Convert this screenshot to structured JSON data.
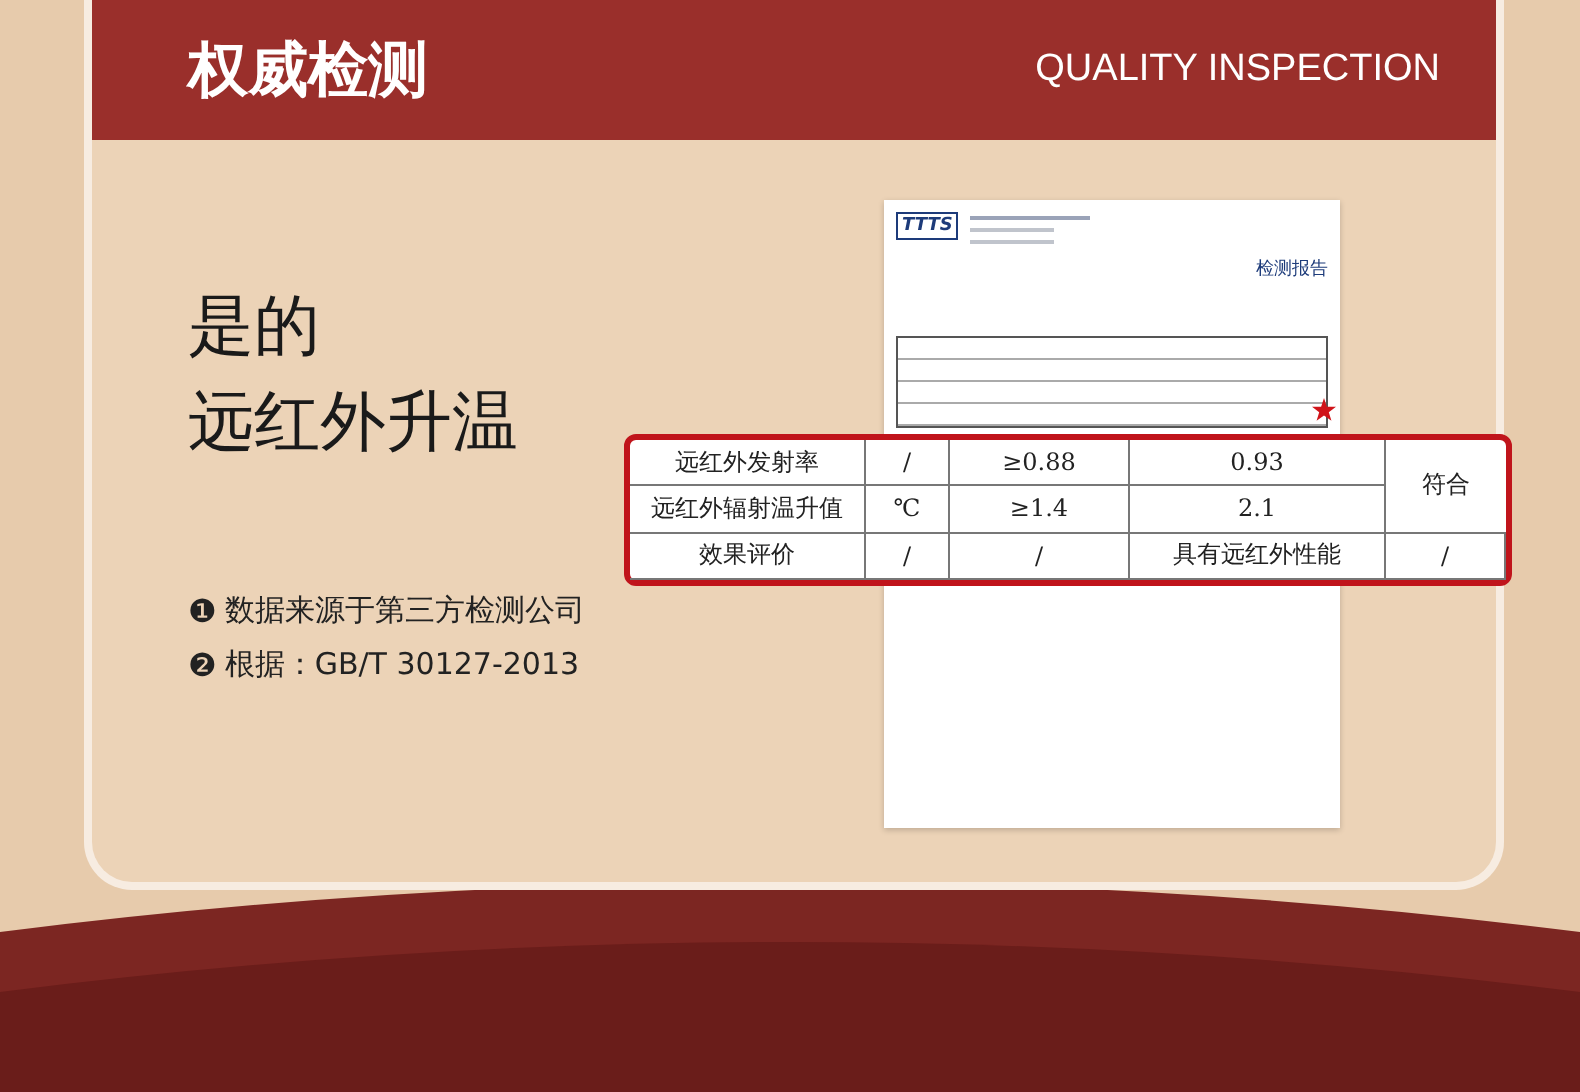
{
  "header": {
    "title": "权威检测",
    "subtitle": "QUALITY INSPECTION"
  },
  "headline": [
    "是的",
    "远红外升温"
  ],
  "notes": [
    {
      "marker": "❶",
      "text": "数据来源于第三方检测公司"
    },
    {
      "marker": "❷",
      "text": "根据：GB/T 30127-2013"
    }
  ],
  "report": {
    "logo": "TTTS",
    "title": "检测报告"
  },
  "table": {
    "rows": [
      [
        "远红外发射率",
        "/",
        "≥0.88",
        "0.93"
      ],
      [
        "远红外辐射温升值",
        "℃",
        "≥1.4",
        "2.1"
      ],
      [
        "效果评价",
        "/",
        "/",
        "具有远红外性能",
        "/"
      ]
    ],
    "verdict": "符合"
  }
}
